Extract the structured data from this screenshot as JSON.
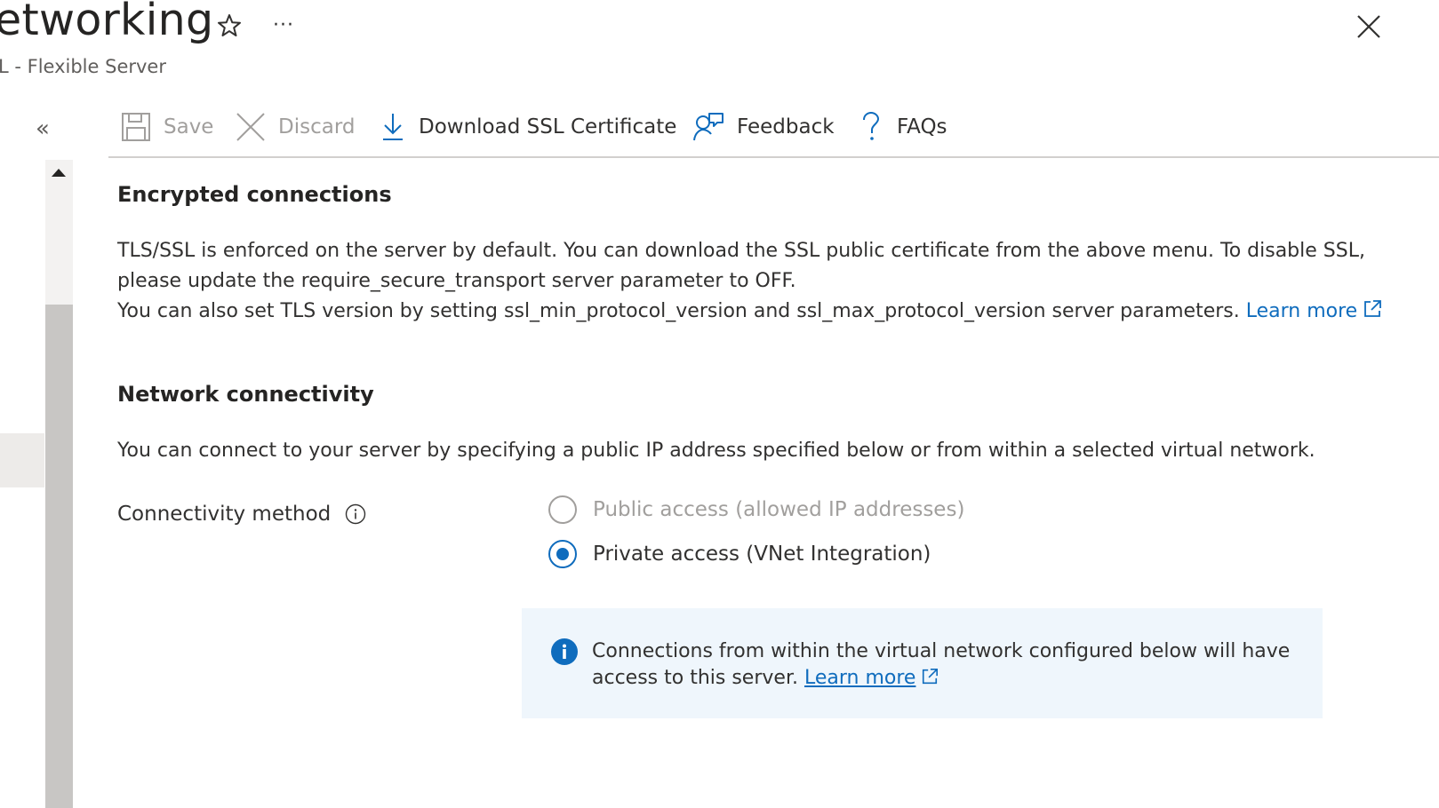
{
  "header": {
    "title": "etworking",
    "subtitle": "L - Flexible Server",
    "more_label": "···"
  },
  "toolbar": {
    "save_label": "Save",
    "discard_label": "Discard",
    "download_label": "Download SSL Certificate",
    "feedback_label": "Feedback",
    "faqs_label": "FAQs"
  },
  "nav": {
    "collapse_label": "«"
  },
  "encrypted": {
    "heading": "Encrypted connections",
    "line1": "TLS/SSL is enforced on the server by default. You can download the SSL public certificate from the above menu. To disable SSL,",
    "line2": "please update the require_secure_transport server parameter to OFF.",
    "line3": "You can also set TLS version by setting ssl_min_protocol_version and ssl_max_protocol_version server parameters.",
    "learn_more": "Learn more"
  },
  "network": {
    "heading": "Network connectivity",
    "description": "You can connect to your server by specifying a public IP address specified below or from within a selected virtual network.",
    "connectivity_label": "Connectivity method",
    "options": [
      {
        "label": "Public access (allowed IP addresses)",
        "selected": false,
        "disabled": true
      },
      {
        "label": "Private access (VNet Integration)",
        "selected": true,
        "disabled": false
      }
    ],
    "info_line1": "Connections from within the virtual network configured below will have",
    "info_line2": "access to this server.",
    "info_learn_more": "Learn more"
  },
  "colors": {
    "accent": "#0f6cbd",
    "disabled": "#a19f9d",
    "info_background": "#eff6fc"
  }
}
